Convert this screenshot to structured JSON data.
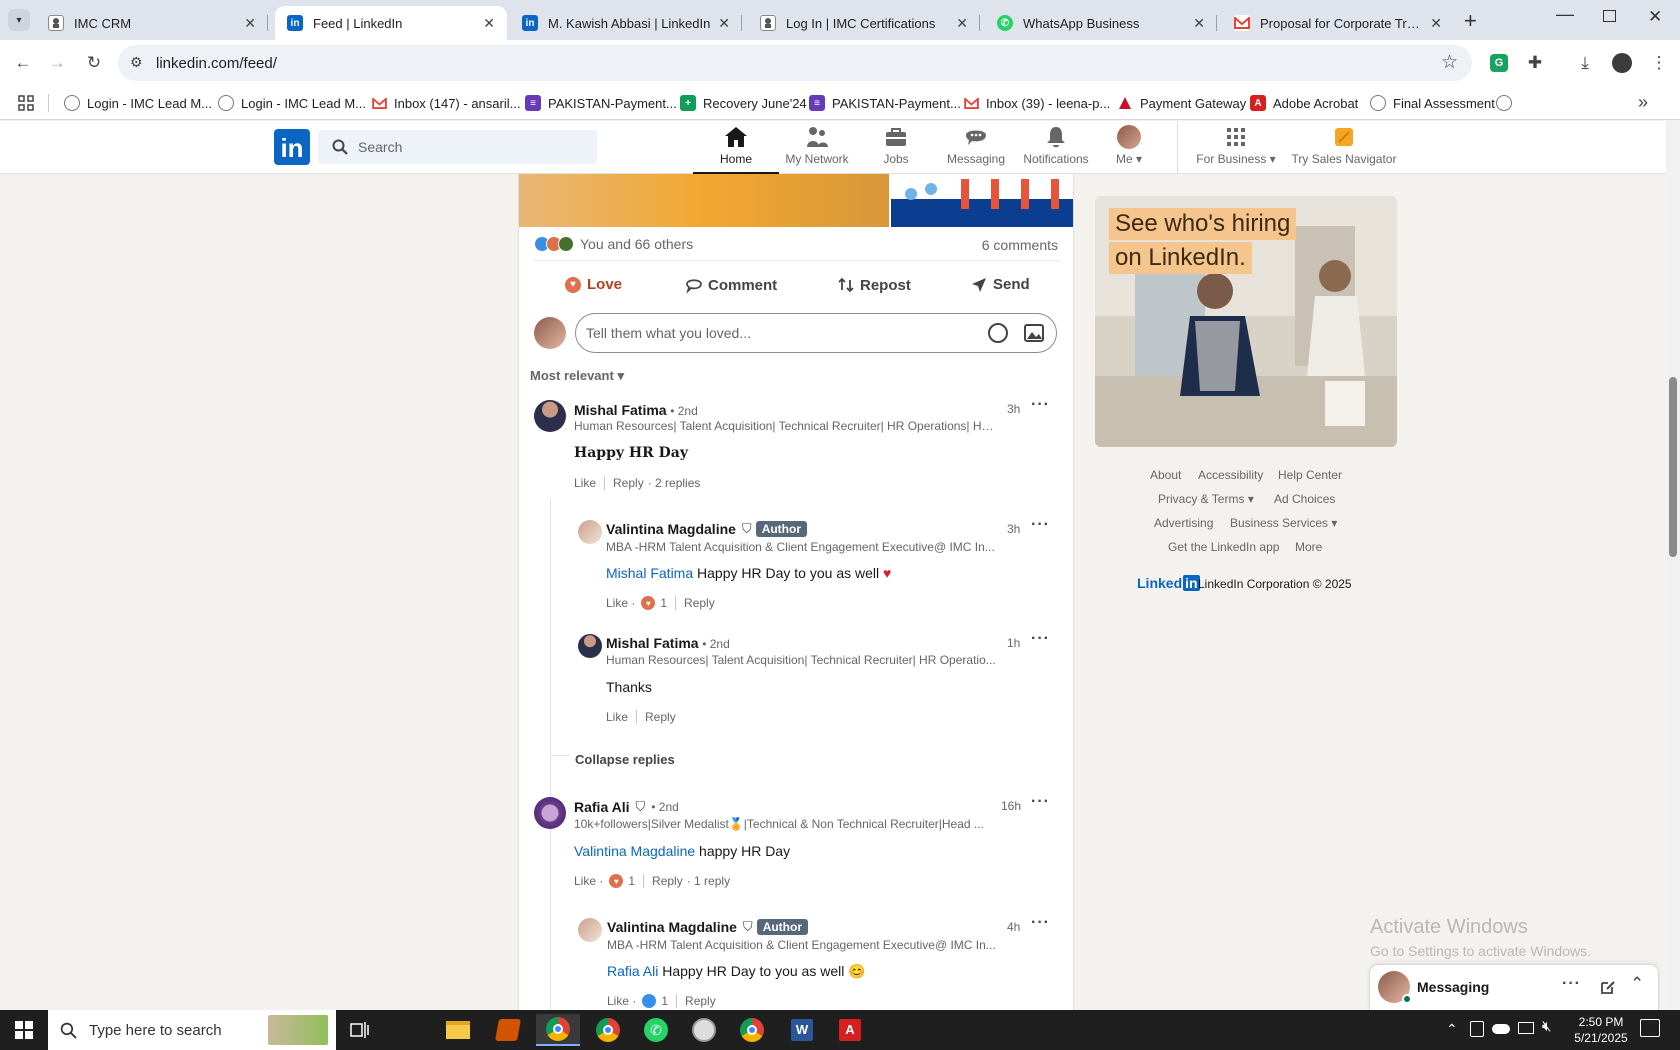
{
  "browser": {
    "tabs": [
      {
        "title": "IMC CRM",
        "active": false
      },
      {
        "title": "Feed | LinkedIn",
        "active": true
      },
      {
        "title": "M. Kawish Abbasi | LinkedIn",
        "active": false
      },
      {
        "title": "Log In | IMC Certifications",
        "active": false
      },
      {
        "title": "WhatsApp Business",
        "active": false
      },
      {
        "title": "Proposal for Corporate Training",
        "active": false
      }
    ],
    "url": "linkedin.com/feed/",
    "bookmarks": [
      "Login - IMC Lead M...",
      "Login - IMC Lead M...",
      "Inbox (147) - ansaril...",
      "PAKISTAN-Payment...",
      "Recovery June'24",
      "PAKISTAN-Payment...",
      "Inbox (39) - leena-p...",
      "Payment Gateway",
      "Adobe Acrobat",
      "Final Assessment"
    ]
  },
  "nav": {
    "search_placeholder": "Search",
    "items": [
      {
        "label": "Home"
      },
      {
        "label": "My Network"
      },
      {
        "label": "Jobs"
      },
      {
        "label": "Messaging"
      },
      {
        "label": "Notifications"
      },
      {
        "label": "Me"
      },
      {
        "label": "For Business"
      },
      {
        "label": "Try Sales Navigator"
      }
    ]
  },
  "post": {
    "reactions_text": "You and 66 others",
    "comments_count": "6 comments",
    "actions": {
      "love": "Love",
      "comment": "Comment",
      "repost": "Repost",
      "send": "Send"
    },
    "comment_placeholder": "Tell them what you loved...",
    "sort_label": "Most relevant"
  },
  "comments": {
    "c1": {
      "name": "Mishal Fatima",
      "degree": "• 2nd",
      "headline": "Human Resources| Talent Acquisition| Technical Recruiter| HR Operations| HR ...",
      "time": "3h",
      "text": "Happy HR Day",
      "like": "Like",
      "reply": "Reply",
      "replies": "· 2 replies"
    },
    "r1": {
      "name": "Valintina Magdaline",
      "badge": "Author",
      "headline": "MBA -HRM Talent Acquisition & Client Engagement Executive@ IMC In...",
      "time": "3h",
      "mention": "Mishal Fatima",
      "text": "Happy HR Day to you as well",
      "like": "Like ·",
      "reaction_count": "1",
      "reply": "Reply"
    },
    "r2": {
      "name": "Mishal Fatima",
      "degree": "• 2nd",
      "headline": "Human Resources| Talent Acquisition| Technical Recruiter| HR Operatio...",
      "time": "1h",
      "text": "Thanks",
      "like": "Like",
      "reply": "Reply"
    },
    "collapse": "Collapse replies",
    "c2": {
      "name": "Rafia Ali",
      "degree": "• 2nd",
      "headline": "10k+followers|Silver Medalist🏅|Technical & Non Technical Recruiter|Head ...",
      "time": "16h",
      "mention": "Valintina Magdaline",
      "text": "happy HR Day",
      "like": "Like ·",
      "reaction_count": "1",
      "reply": "Reply",
      "replies": "· 1 reply"
    },
    "r3": {
      "name": "Valintina Magdaline",
      "badge": "Author",
      "headline": "MBA -HRM Talent Acquisition & Client Engagement Executive@ IMC In...",
      "time": "4h",
      "mention": "Rafia Ali",
      "text": "Happy HR Day to you as well 😊",
      "like": "Like ·",
      "reaction_count": "1",
      "reply": "Reply"
    }
  },
  "ad": {
    "line1": "See who's hiring",
    "line2": "on LinkedIn."
  },
  "footer": {
    "about": "About",
    "accessibility": "Accessibility",
    "help": "Help Center",
    "privacy": "Privacy & Terms",
    "adchoices": "Ad Choices",
    "advertising": "Advertising",
    "business": "Business Services",
    "getapp": "Get the LinkedIn app",
    "more": "More",
    "logo": "Linked",
    "copyright": "LinkedIn Corporation © 2025"
  },
  "watermark": {
    "title": "Activate Windows",
    "subtitle": "Go to Settings to activate Windows."
  },
  "messaging": {
    "label": "Messaging"
  },
  "taskbar": {
    "search_placeholder": "Type here to search",
    "time": "2:50 PM",
    "date": "5/21/2025"
  }
}
